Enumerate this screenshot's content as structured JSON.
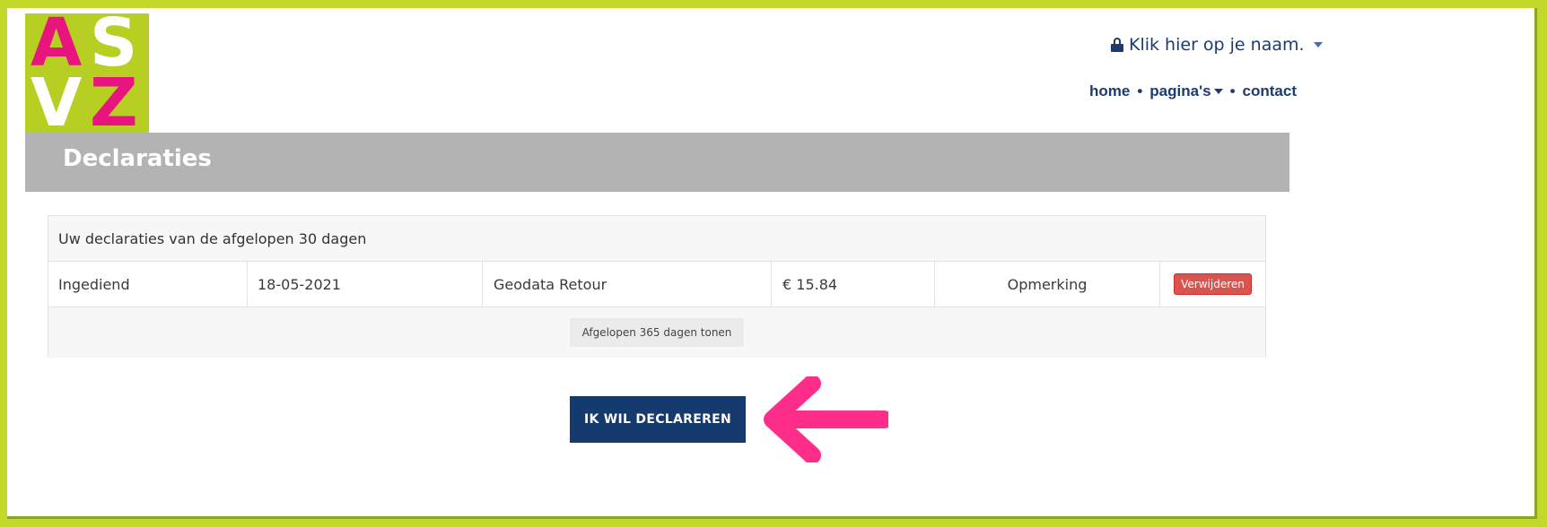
{
  "logo": {
    "letters": [
      "A",
      "S",
      "V",
      "Z"
    ]
  },
  "header": {
    "account_label": "Klik hier op je naam.",
    "nav": {
      "home": "home",
      "pages": "pagina's",
      "contact": "contact",
      "separator": "•"
    }
  },
  "page": {
    "title": "Declaraties"
  },
  "declarations": {
    "heading": "Uw declaraties van de afgelopen 30 dagen",
    "rows": [
      {
        "status": "Ingediend",
        "date": "18-05-2021",
        "type": "Geodata Retour",
        "amount": "€ 15.84",
        "remark": "Opmerking",
        "delete_label": "Verwijderen"
      }
    ],
    "show_more_label": "Afgelopen 365 dagen tonen"
  },
  "cta": {
    "label": "IK WIL DECLAREREN"
  },
  "colors": {
    "brand_green": "#c2d92a",
    "brand_pink": "#e8157e",
    "navy": "#143a6e",
    "danger": "#d9534f",
    "arrow": "#ff2d8a"
  }
}
